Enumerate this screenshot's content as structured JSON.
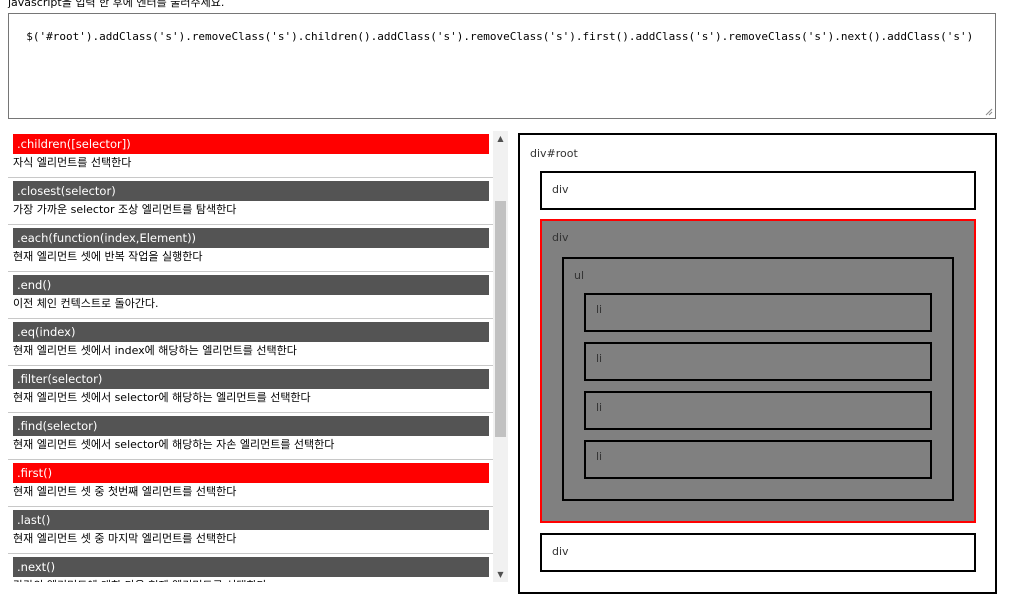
{
  "instruction": "javascript을 입력 한 후에 엔터를 눌러주세요.",
  "code": "$('#root').addClass('s').removeClass('s').children().addClass('s').removeClass('s').first().addClass('s').removeClass('s').next().addClass('s')",
  "colors": {
    "active": "#ff0000",
    "title_bg": "#545454",
    "selected_bg": "#808080",
    "selected_border": "#ff0000"
  },
  "methods": [
    {
      "name": ".children([selector])",
      "desc": "자식 엘리먼트를 선택한다",
      "active": true
    },
    {
      "name": ".closest(selector)",
      "desc": "가장 가까운 selector 조상 엘리먼트를 탐색한다",
      "active": false
    },
    {
      "name": ".each(function(index,Element))",
      "desc": "현재 엘리먼트 셋에 반복 작업을 실행한다",
      "active": false
    },
    {
      "name": ".end()",
      "desc": "이전 체인 컨텍스트로 돌아간다.",
      "active": false
    },
    {
      "name": ".eq(index)",
      "desc": "현재 엘리먼트 셋에서 index에 해당하는 엘리먼트를 선택한다",
      "active": false
    },
    {
      "name": ".filter(selector)",
      "desc": "현재 엘리먼트 셋에서 selector에 해당하는 엘리먼트를 선택한다",
      "active": false
    },
    {
      "name": ".find(selector)",
      "desc": "현재 엘리먼트 셋에서 selector에 해당하는 자손 엘리먼트를 선택한다",
      "active": false
    },
    {
      "name": ".first()",
      "desc": "현재 엘리먼트 셋 중 첫번째 엘리먼트를 선택한다",
      "active": true
    },
    {
      "name": ".last()",
      "desc": "현재 엘리먼트 셋 중 마지막 엘리먼트를 선택한다",
      "active": false
    },
    {
      "name": ".next()",
      "desc": "각각의 엘리먼트에 대한 다음 형제 엘리먼트를 선택한다.",
      "active": false
    }
  ],
  "preview": {
    "root_label": "div#root",
    "div1": "div",
    "div2": "div",
    "ul": "ul",
    "li": [
      "li",
      "li",
      "li",
      "li"
    ],
    "div3": "div"
  }
}
